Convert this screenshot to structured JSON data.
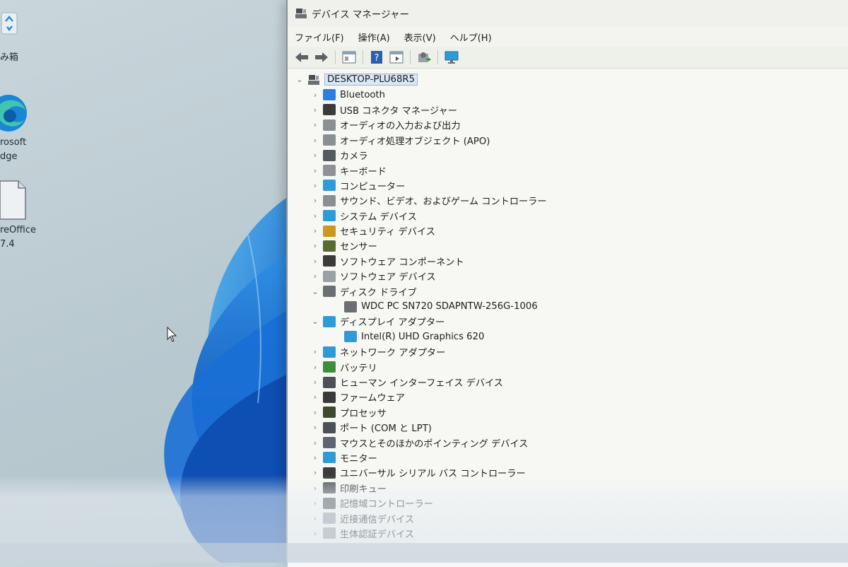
{
  "desktop": {
    "icons": [
      {
        "label_lines": [
          "み箱"
        ]
      },
      {
        "label_lines": [
          "rosoft",
          "dge"
        ]
      },
      {
        "label_lines": [
          "reOffice",
          "7.4"
        ]
      }
    ]
  },
  "window": {
    "title": "デバイス マネージャー",
    "menu": [
      "ファイル(F)",
      "操作(A)",
      "表示(V)",
      "ヘルプ(H)"
    ],
    "toolbar_icons": [
      "back-arrow-icon",
      "forward-arrow-icon",
      "properties-icon",
      "help-icon",
      "action-pane-icon",
      "update-driver-icon",
      "monitor-icon"
    ],
    "tree": {
      "root": "DESKTOP-PLU68R5",
      "items": [
        {
          "label": "Bluetooth",
          "icon": "bluetooth-icon",
          "color": "#2f7de1",
          "expanded": false
        },
        {
          "label": "USB コネクタ マネージャー",
          "icon": "usb-icon",
          "color": "#3b3b3b",
          "expanded": false
        },
        {
          "label": "オーディオの入力および出力",
          "icon": "speaker-icon",
          "color": "#8a8f94",
          "expanded": false
        },
        {
          "label": "オーディオ処理オブジェクト (APO)",
          "icon": "speaker-icon",
          "color": "#8a8f94",
          "expanded": false
        },
        {
          "label": "カメラ",
          "icon": "camera-icon",
          "color": "#555a5e",
          "expanded": false
        },
        {
          "label": "キーボード",
          "icon": "keyboard-icon",
          "color": "#8e9296",
          "expanded": false
        },
        {
          "label": "コンピューター",
          "icon": "computer-icon",
          "color": "#2e9bd6",
          "expanded": false
        },
        {
          "label": "サウンド、ビデオ、およびゲーム コントローラー",
          "icon": "speaker-icon",
          "color": "#8a8f94",
          "expanded": false
        },
        {
          "label": "システム デバイス",
          "icon": "system-device-icon",
          "color": "#2e9bd6",
          "expanded": false
        },
        {
          "label": "セキュリティ デバイス",
          "icon": "security-icon",
          "color": "#c99a1d",
          "expanded": false
        },
        {
          "label": "センサー",
          "icon": "sensor-icon",
          "color": "#5a6b2f",
          "expanded": false
        },
        {
          "label": "ソフトウェア コンポーネント",
          "icon": "software-component-icon",
          "color": "#3a3a3a",
          "expanded": false
        },
        {
          "label": "ソフトウェア デバイス",
          "icon": "software-device-icon",
          "color": "#9aa0a5",
          "expanded": false
        },
        {
          "label": "ディスク ドライブ",
          "icon": "disk-drive-icon",
          "color": "#6b6f73",
          "expanded": true,
          "children": [
            {
              "label": "WDC PC SN720 SDAPNTW-256G-1006",
              "icon": "disk-drive-icon",
              "color": "#6b6f73"
            }
          ]
        },
        {
          "label": "ディスプレイ アダプター",
          "icon": "display-adapter-icon",
          "color": "#2e9bd6",
          "expanded": true,
          "children": [
            {
              "label": "Intel(R) UHD Graphics 620",
              "icon": "display-adapter-icon",
              "color": "#2e9bd6"
            }
          ]
        },
        {
          "label": "ネットワーク アダプター",
          "icon": "network-icon",
          "color": "#2e9bd6",
          "expanded": false
        },
        {
          "label": "バッテリ",
          "icon": "battery-icon",
          "color": "#3f8f3a",
          "expanded": false
        },
        {
          "label": "ヒューマン インターフェイス デバイス",
          "icon": "hid-icon",
          "color": "#4c5156",
          "expanded": false
        },
        {
          "label": "ファームウェア",
          "icon": "firmware-icon",
          "color": "#3a3a3a",
          "expanded": false
        },
        {
          "label": "プロセッサ",
          "icon": "processor-icon",
          "color": "#3e4a2e",
          "expanded": false
        },
        {
          "label": "ポート (COM と LPT)",
          "icon": "port-icon",
          "color": "#4c5156",
          "expanded": false
        },
        {
          "label": "マウスとそのほかのポインティング デバイス",
          "icon": "mouse-icon",
          "color": "#5e6570",
          "expanded": false
        },
        {
          "label": "モニター",
          "icon": "monitor-icon",
          "color": "#2e9bd6",
          "expanded": false
        },
        {
          "label": "ユニバーサル シリアル バス コントローラー",
          "icon": "usb-icon",
          "color": "#3b3b3b",
          "expanded": false
        },
        {
          "label": "印刷キュー",
          "icon": "printer-icon",
          "color": "#555a5e",
          "expanded": false
        },
        {
          "label": "記憶域コントローラー",
          "icon": "storage-controller-icon",
          "color": "#4c5156",
          "expanded": false
        },
        {
          "label": "近接通信デバイス",
          "icon": "proximity-icon",
          "color": "#9aa0a5",
          "expanded": false
        },
        {
          "label": "生体認証デバイス",
          "icon": "biometric-icon",
          "color": "#9aa0a5",
          "expanded": false
        }
      ]
    }
  }
}
